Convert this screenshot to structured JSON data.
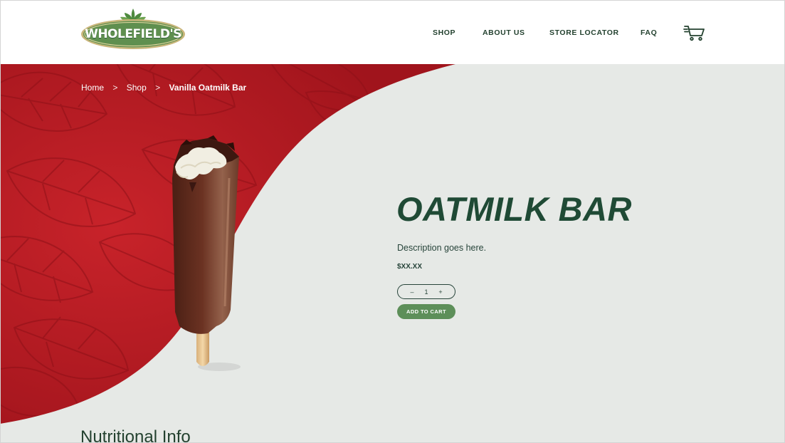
{
  "brand": {
    "logo_text": "WHOLEFIELD'S"
  },
  "nav": {
    "items": [
      {
        "label": "SHOP"
      },
      {
        "label": "ABOUT US"
      },
      {
        "label": "STORE LOCATOR"
      },
      {
        "label": "FAQ"
      }
    ],
    "cart_icon": "shopping-cart-icon"
  },
  "breadcrumb": {
    "items": [
      {
        "label": "Home"
      },
      {
        "label": "Shop"
      },
      {
        "label": "Vanilla Oatmilk Bar"
      }
    ],
    "separator": ">"
  },
  "product": {
    "title": "OATMILK BAR",
    "description": "Description goes here.",
    "price": "$XX.XX",
    "quantity": "1",
    "qty_minus": "–",
    "qty_plus": "+",
    "add_to_cart": "ADD TO CART"
  },
  "section": {
    "nutritional_heading": "Nutritional Info"
  },
  "colors": {
    "hero_red": "#b81e25",
    "page_bg": "#e6e9e6",
    "brand_green": "#1f4a35",
    "button_green": "#5d8f59"
  }
}
